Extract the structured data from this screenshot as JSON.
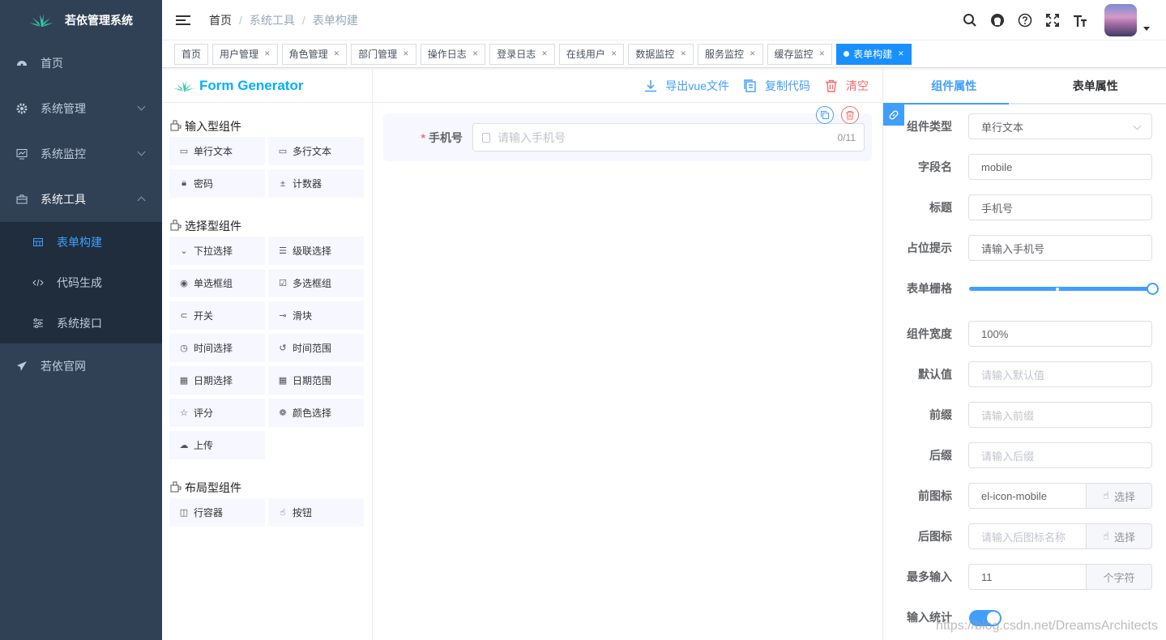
{
  "sidebar": {
    "title": "若依管理系统",
    "items": [
      {
        "label": "首页",
        "icon": "dashboard-icon"
      },
      {
        "label": "系统管理",
        "icon": "gear-icon"
      },
      {
        "label": "系统监控",
        "icon": "monitor-icon"
      },
      {
        "label": "系统工具",
        "icon": "toolbox-icon"
      }
    ],
    "sub_items": [
      {
        "label": "表单构建",
        "icon": "grid-icon",
        "active": true
      },
      {
        "label": "代码生成",
        "icon": "code-icon"
      },
      {
        "label": "系统接口",
        "icon": "sliders-icon"
      }
    ],
    "external": {
      "label": "若依官网",
      "icon": "paper-plane-icon"
    }
  },
  "navbar": {
    "breadcrumb": [
      "首页",
      "系统工具",
      "表单构建"
    ]
  },
  "tags": [
    "首页",
    "用户管理",
    "角色管理",
    "部门管理",
    "操作日志",
    "登录日志",
    "在线用户",
    "数据监控",
    "服务监控",
    "缓存监控",
    "表单构建"
  ],
  "generator": {
    "logo": "Form Generator",
    "actions": {
      "export": "导出vue文件",
      "copy": "复制代码",
      "clear": "清空"
    },
    "groups": [
      {
        "title": "输入型组件",
        "items": [
          "单行文本",
          "多行文本",
          "密码",
          "计数器"
        ]
      },
      {
        "title": "选择型组件",
        "items": [
          "下拉选择",
          "级联选择",
          "单选框组",
          "多选框组",
          "开关",
          "滑块",
          "时间选择",
          "时间范围",
          "日期选择",
          "日期范围",
          "评分",
          "颜色选择",
          "上传"
        ]
      },
      {
        "title": "布局型组件",
        "items": [
          "行容器",
          "按钮"
        ]
      }
    ],
    "canvas": {
      "label": "手机号",
      "placeholder": "请输入手机号",
      "count": "0/11"
    }
  },
  "props": {
    "tabs": [
      "组件属性",
      "表单属性"
    ],
    "rows": [
      {
        "label": "组件类型",
        "value": "单行文本",
        "type": "select"
      },
      {
        "label": "字段名",
        "value": "mobile"
      },
      {
        "label": "标题",
        "value": "手机号"
      },
      {
        "label": "占位提示",
        "value": "请输入手机号"
      },
      {
        "label": "表单栅格",
        "type": "slider"
      },
      {
        "label": "组件宽度",
        "value": "100%"
      },
      {
        "label": "默认值",
        "placeholder": "请输入默认值"
      },
      {
        "label": "前缀",
        "placeholder": "请输入前缀"
      },
      {
        "label": "后缀",
        "placeholder": "请输入后缀"
      },
      {
        "label": "前图标",
        "value": "el-icon-mobile",
        "append": "选择"
      },
      {
        "label": "后图标",
        "placeholder": "请输入后图标名称",
        "append": "选择"
      },
      {
        "label": "最多输入",
        "value": "11",
        "append": "个字符"
      },
      {
        "label": "输入统计",
        "type": "switch"
      }
    ],
    "slider_value": 1.0,
    "switch_on": true
  },
  "watermark": "https://blog.csdn.net/DreamsArchitects",
  "colors": {
    "primary": "#409eff",
    "danger": "#f56c6c",
    "sidebar": "#304156"
  }
}
